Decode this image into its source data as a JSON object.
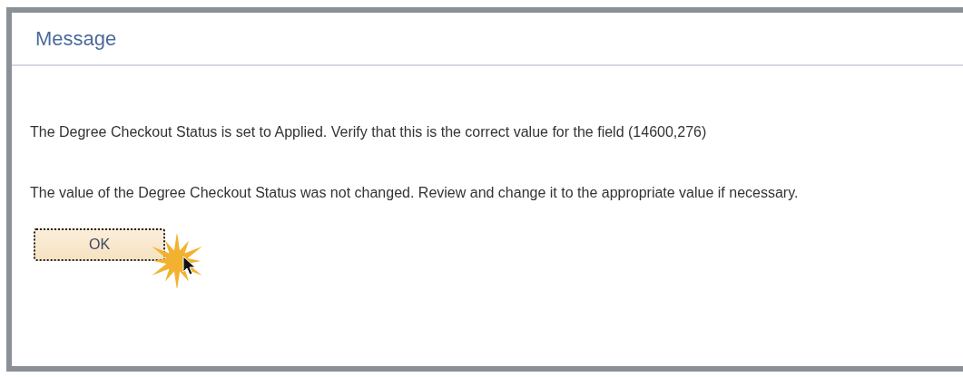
{
  "dialog": {
    "title": "Message",
    "paragraphs": [
      "The Degree Checkout Status is set to Applied.  Verify that this is the correct value for the field (14600,276)",
      "The value of the Degree Checkout Status was not changed.  Review and change it to the appropriate value if necessary."
    ],
    "buttons": [
      {
        "label": "OK",
        "focused": true
      }
    ]
  }
}
